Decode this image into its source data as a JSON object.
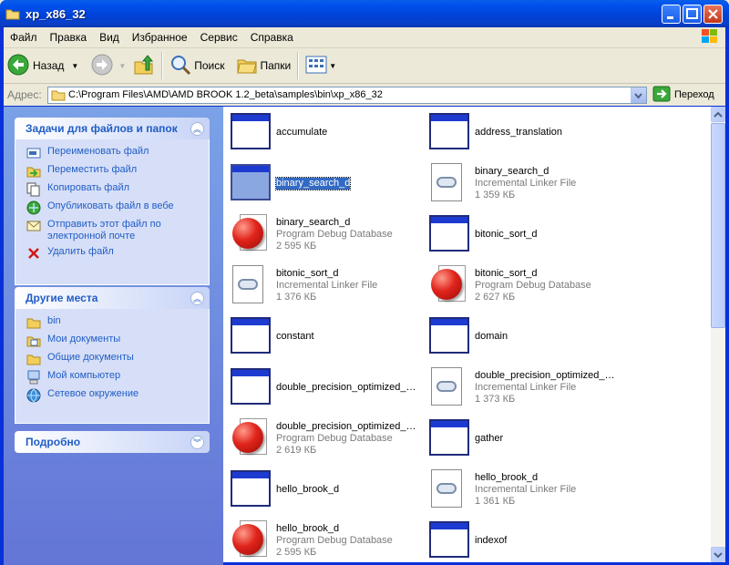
{
  "window": {
    "title": "xp_x86_32"
  },
  "menu": [
    "Файл",
    "Правка",
    "Вид",
    "Избранное",
    "Сервис",
    "Справка"
  ],
  "toolbar": {
    "back": "Назад",
    "search": "Поиск",
    "folders": "Папки"
  },
  "address": {
    "label": "Адрес:",
    "path": "C:\\Program Files\\AMD\\AMD BROOK 1.2_beta\\samples\\bin\\xp_x86_32",
    "go": "Переход"
  },
  "tasks": {
    "title": "Задачи для файлов и папок",
    "items": [
      "Переименовать файл",
      "Переместить файл",
      "Копировать файл",
      "Опубликовать файл в вебе",
      "Отправить этот файл по электронной почте",
      "Удалить файл"
    ]
  },
  "places": {
    "title": "Другие места",
    "items": [
      "bin",
      "Мои документы",
      "Общие документы",
      "Мой компьютер",
      "Сетевое окружение"
    ]
  },
  "details": {
    "title": "Подробно"
  },
  "files": [
    {
      "name": "accumulate",
      "type": "",
      "size": "",
      "icon": "exe-icon"
    },
    {
      "name": "address_translation",
      "type": "",
      "size": "",
      "icon": "exe-icon"
    },
    {
      "name": "binary_search_d",
      "type": "",
      "size": "",
      "icon": "exe-icon",
      "selected": true
    },
    {
      "name": "binary_search_d",
      "type": "Incremental Linker File",
      "size": "1 359 КБ",
      "icon": "ilk-icon"
    },
    {
      "name": "binary_search_d",
      "type": "Program Debug Database",
      "size": "2 595 КБ",
      "icon": "pdb-icon"
    },
    {
      "name": "bitonic_sort_d",
      "type": "",
      "size": "",
      "icon": "exe-icon"
    },
    {
      "name": "bitonic_sort_d",
      "type": "Incremental Linker File",
      "size": "1 376 КБ",
      "icon": "ilk-icon"
    },
    {
      "name": "bitonic_sort_d",
      "type": "Program Debug Database",
      "size": "2 627 КБ",
      "icon": "pdb-icon"
    },
    {
      "name": "constant",
      "type": "",
      "size": "",
      "icon": "exe-icon"
    },
    {
      "name": "domain",
      "type": "",
      "size": "",
      "icon": "exe-icon"
    },
    {
      "name": "double_precision_optimized_m...",
      "type": "",
      "size": "",
      "icon": "exe-icon"
    },
    {
      "name": "double_precision_optimized_m...",
      "type": "Incremental Linker File",
      "size": "1 373 КБ",
      "icon": "ilk-icon"
    },
    {
      "name": "double_precision_optimized_m...",
      "type": "Program Debug Database",
      "size": "2 619 КБ",
      "icon": "pdb-icon"
    },
    {
      "name": "gather",
      "type": "",
      "size": "",
      "icon": "exe-icon"
    },
    {
      "name": "hello_brook_d",
      "type": "",
      "size": "",
      "icon": "exe-icon"
    },
    {
      "name": "hello_brook_d",
      "type": "Incremental Linker File",
      "size": "1 361 КБ",
      "icon": "ilk-icon"
    },
    {
      "name": "hello_brook_d",
      "type": "Program Debug Database",
      "size": "2 595 КБ",
      "icon": "pdb-icon"
    },
    {
      "name": "indexof",
      "type": "",
      "size": "",
      "icon": "exe-icon"
    }
  ]
}
